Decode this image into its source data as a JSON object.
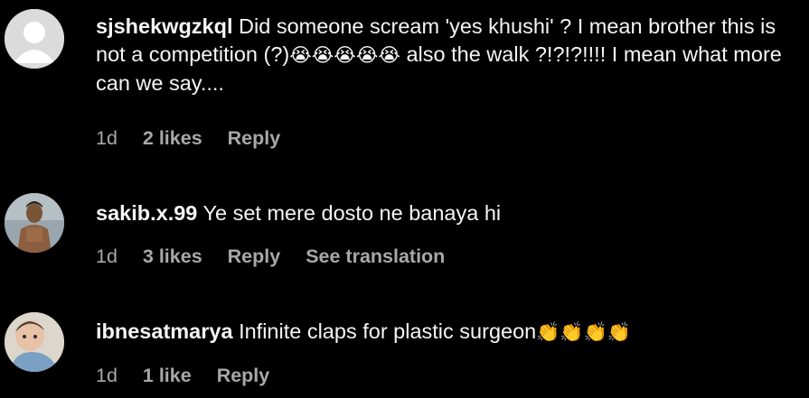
{
  "comments": [
    {
      "username": "sjshekwgzkql",
      "text": "Did someone scream 'yes khushi' ? I mean brother this is not a competition (?)",
      "emoji": "😭😭😭😭😭",
      "text_after": " also the walk ?!?!?!!!! I mean what more can we say....",
      "time": "1d",
      "likes": "2 likes",
      "reply": "Reply",
      "avatar_icon": "default-avatar-icon"
    },
    {
      "username": "sakib.x.99",
      "text": "Ye set mere dosto ne banaya hi",
      "time": "1d",
      "likes": "3 likes",
      "reply": "Reply",
      "translation": "See translation",
      "avatar_icon": "profile-photo"
    },
    {
      "username": "ibnesatmarya",
      "text": "Infinite claps for plastic surgeon",
      "emoji": "👏👏👏👏",
      "time": "1d",
      "likes": "1 like",
      "reply": "Reply",
      "avatar_icon": "profile-photo"
    }
  ],
  "colors": {
    "background": "#000000",
    "text": "#f5f5f5",
    "meta": "#a8a8a8"
  }
}
